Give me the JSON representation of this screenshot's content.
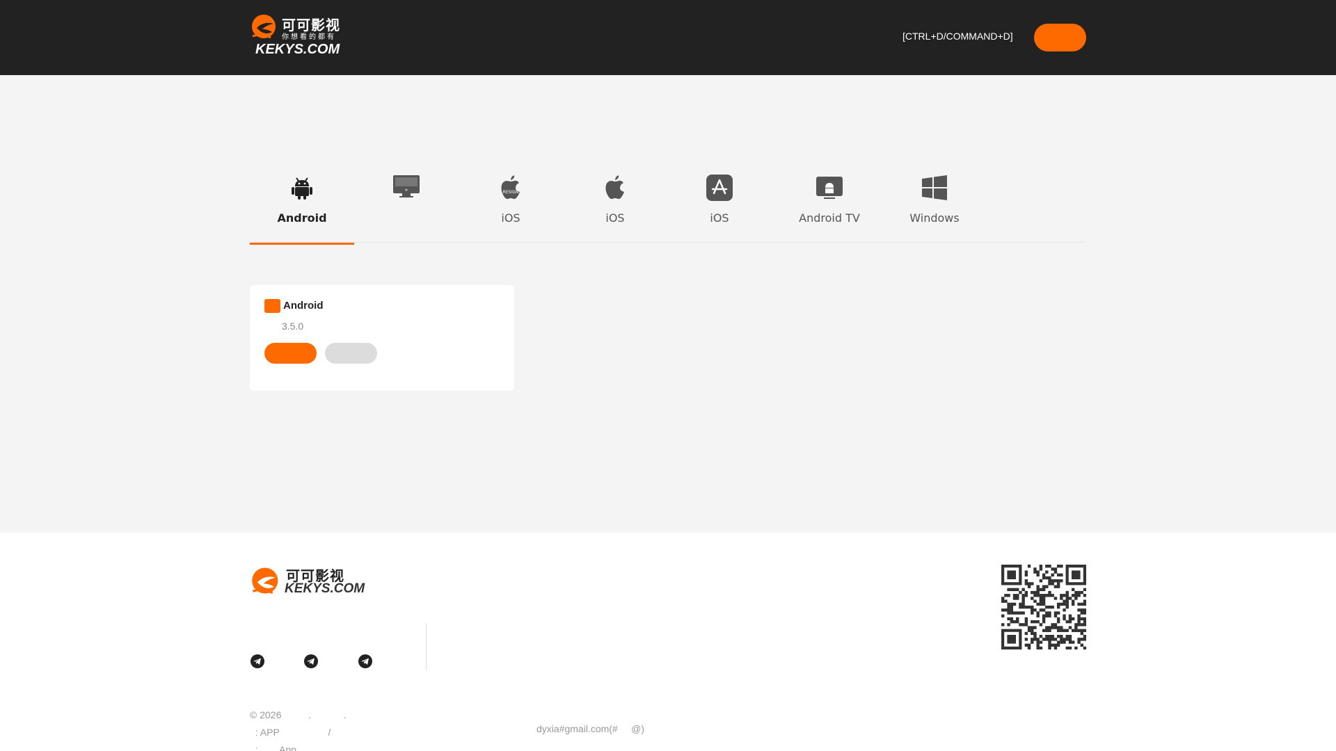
{
  "header": {
    "logo_cn": "可可影视",
    "logo_slogan": "你想看的都有",
    "logo_en": "KEKYS.COM",
    "hotkey_text": "[CTRL+D/COMMAND+D]",
    "action_button_label": ""
  },
  "tabs": [
    {
      "label": "Android",
      "icon": "android-icon",
      "active": true
    },
    {
      "label": "",
      "icon": "desktop-icon",
      "active": false
    },
    {
      "label": "iOS",
      "icon": "apple-resign-icon",
      "active": false
    },
    {
      "label": "iOS",
      "icon": "apple-icon",
      "active": false
    },
    {
      "label": "iOS",
      "icon": "app-store-icon",
      "active": false
    },
    {
      "label": "Android TV",
      "icon": "android-tv-icon",
      "active": false
    },
    {
      "label": "Windows",
      "icon": "windows-icon",
      "active": false
    }
  ],
  "card": {
    "title": "Android",
    "version": "3.5.0",
    "primary_button_label": "",
    "secondary_button_label": ""
  },
  "footer": {
    "logo_cn": "可可影视",
    "logo_en": "KEKYS.COM",
    "social_icons": [
      "telegram-icon",
      "telegram-icon",
      "telegram-icon"
    ],
    "copyright_line1": "© 2026          .            .",
    "copyright_line2": "  : APP                  /",
    "copyright_line3": "  :        App            .",
    "email": "dyxia#gmail.com(#     @)"
  },
  "colors": {
    "accent": "#ff6a00",
    "header_bg": "#222222",
    "page_bg": "#f4f4f4"
  }
}
